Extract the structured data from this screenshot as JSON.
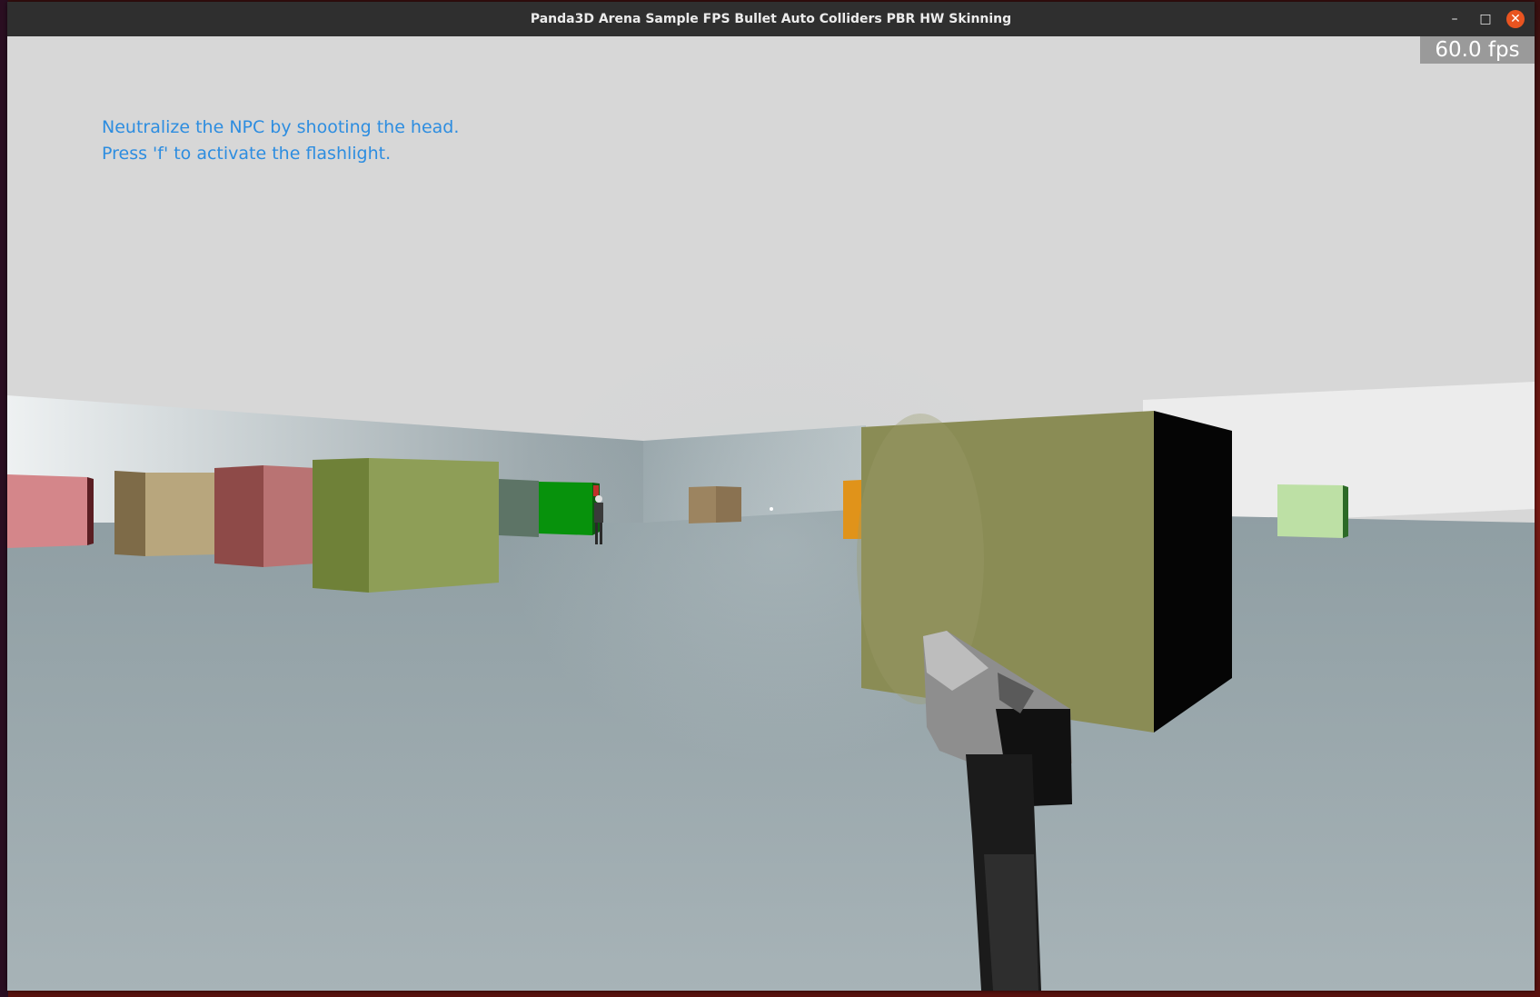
{
  "window": {
    "title": "Panda3D Arena Sample FPS Bullet Auto Colliders PBR HW Skinning",
    "controls": {
      "minimize": "–",
      "maximize": "□",
      "close": "✕"
    }
  },
  "hud": {
    "fps": "60.0 fps",
    "instructions": [
      "Neutralize the NPC by shooting the head.",
      "Press 'f' to activate the flashlight."
    ]
  },
  "colors": {
    "instruction_text": "#2d8de0",
    "close_button": "#e95420",
    "sky": "#d7d7d7",
    "floor": "#a3b0b5"
  },
  "scene": {
    "objects": [
      "pink-box",
      "tan-box",
      "red-box",
      "olive-box",
      "teal-box",
      "green-box",
      "npc",
      "brown-box",
      "orange-box",
      "large-olive-box",
      "light-green-box",
      "crosshair",
      "pistol"
    ]
  }
}
